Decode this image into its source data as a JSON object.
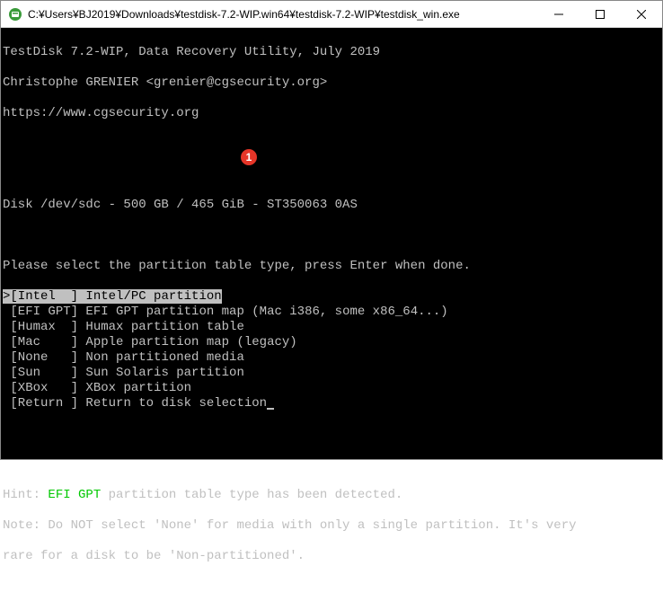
{
  "window": {
    "title": "C:¥Users¥BJ2019¥Downloads¥testdisk-7.2-WIP.win64¥testdisk-7.2-WIP¥testdisk_win.exe"
  },
  "header": {
    "line1": "TestDisk 7.2-WIP, Data Recovery Utility, July 2019",
    "line2": "Christophe GRENIER <grenier@cgsecurity.org>",
    "line3": "https://www.cgsecurity.org"
  },
  "disk_line": "Disk /dev/sdc - 500 GB / 465 GiB - ST350063 0AS",
  "prompt": "Please select the partition table type, press Enter when done.",
  "menu": {
    "items": [
      {
        "marker": ">",
        "tag": "[Intel  ]",
        "desc": " Intel/PC partition",
        "selected": true
      },
      {
        "marker": " ",
        "tag": "[EFI GPT]",
        "desc": " EFI GPT partition map (Mac i386, some x86_64...)",
        "selected": false
      },
      {
        "marker": " ",
        "tag": "[Humax  ]",
        "desc": " Humax partition table",
        "selected": false
      },
      {
        "marker": " ",
        "tag": "[Mac    ]",
        "desc": " Apple partition map (legacy)",
        "selected": false
      },
      {
        "marker": " ",
        "tag": "[None   ]",
        "desc": " Non partitioned media",
        "selected": false
      },
      {
        "marker": " ",
        "tag": "[Sun    ]",
        "desc": " Sun Solaris partition",
        "selected": false
      },
      {
        "marker": " ",
        "tag": "[XBox   ]",
        "desc": " XBox partition",
        "selected": false
      },
      {
        "marker": " ",
        "tag": "[Return ]",
        "desc": " Return to disk selection",
        "selected": false
      }
    ]
  },
  "hint": {
    "prefix": "Hint: ",
    "highlight": "EFI GPT",
    "rest": " partition table type has been detected.",
    "note1": "Note: Do NOT select 'None' for media with only a single partition. It's very",
    "note2": "rare for a disk to be 'Non-partitioned'."
  },
  "annotation": {
    "label": "1"
  }
}
